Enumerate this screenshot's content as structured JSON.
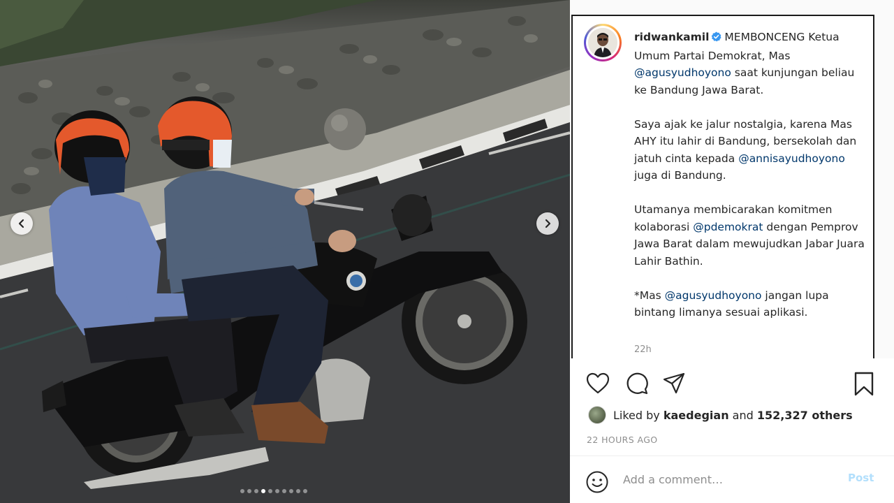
{
  "post": {
    "username": "ridwankamil",
    "verified": true,
    "caption_lines": {
      "p1_text": "MEMBONCENG Ketua Umum Partai Demokrat, Mas",
      "p1_mention": "@agusyudhoyono",
      "p1_rest": "saat kunjungan beliau ke Bandung Jawa Barat.",
      "p2_text": "Saya ajak ke jalur nostalgia, karena Mas AHY itu lahir di Bandung, bersekolah dan jatuh cinta kepada",
      "p2_mention": "@annisayudhoyono",
      "p2_rest": "juga di Bandung.",
      "p3_text": "Utamanya membicarakan komitmen kolaborasi",
      "p3_mention": "@pdemokrat",
      "p3_rest": "dengan Pemprov Jawa Barat dalam mewujudkan Jabar Juara Lahir Bathin.",
      "p4_text": "*Mas",
      "p4_mention": "@agusyudhoyono",
      "p4_rest": "jangan lupa bintang limanya sesuai aplikasi."
    },
    "caption_time": "22h",
    "liked_by_prefix": "Liked by",
    "liked_by_user": "kaedegian",
    "liked_by_and": "and",
    "liked_by_others": "152,327 others",
    "post_time": "22 HOURS AGO",
    "carousel": {
      "count": 10,
      "active_index": 3
    }
  },
  "comment": {
    "placeholder": "Add a comment…",
    "post_label": "Post"
  },
  "icons": {
    "like": "heart-icon",
    "comment": "comment-icon",
    "share": "paper-plane-icon",
    "save": "bookmark-icon",
    "emoji": "smiley-icon",
    "verified": "verified-badge-icon",
    "prev": "chevron-left-icon",
    "next": "chevron-right-icon"
  },
  "colors": {
    "mention": "#00376b",
    "verified": "#3897f0",
    "post_button_disabled": "#b2dffc",
    "muted_text": "#8e8e8e"
  }
}
